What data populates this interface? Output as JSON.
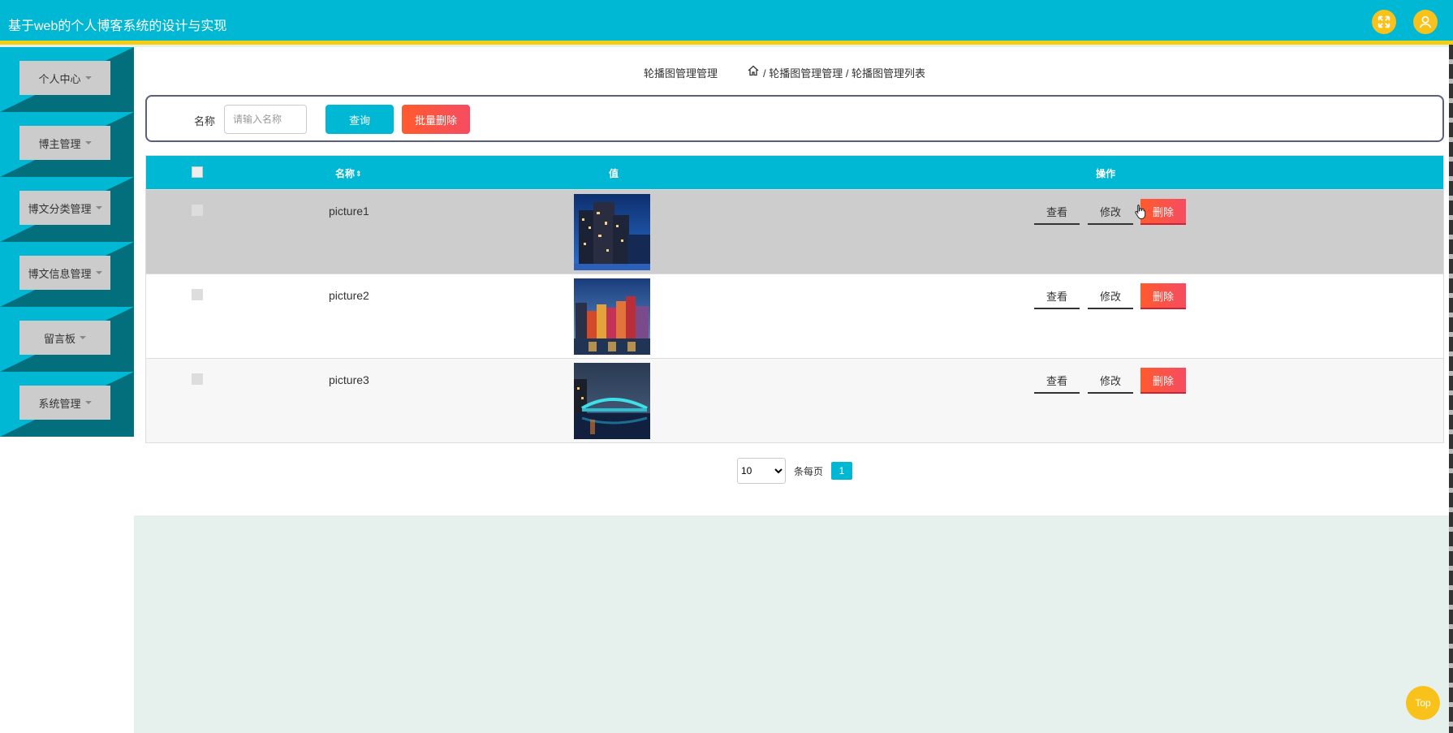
{
  "header": {
    "title": "基于web的个人博客系统的设计与实现",
    "fullscreen_icon": "expand-icon",
    "user_icon": "user-icon",
    "accent": "#00b8d4",
    "stripe": "#f2cf11"
  },
  "sidebar": {
    "items": [
      {
        "label": "个人中心"
      },
      {
        "label": "博主管理"
      },
      {
        "label": "博文分类管理"
      },
      {
        "label": "博文信息管理"
      },
      {
        "label": "留言板"
      },
      {
        "label": "系统管理"
      }
    ]
  },
  "breadcrumb": {
    "title": "轮播图管理管理",
    "path": "/ 轮播图管理管理 / 轮播图管理列表"
  },
  "search": {
    "label": "名称",
    "placeholder": "请输入名称",
    "query_label": "查询",
    "batch_delete_label": "批量删除"
  },
  "table": {
    "headers": {
      "name": "名称",
      "sort": "⇕",
      "value": "值",
      "operation": "操作"
    },
    "rows": [
      {
        "name": "picture1",
        "image": "city-night-image"
      },
      {
        "name": "picture2",
        "image": "colorful-houses-image"
      },
      {
        "name": "picture3",
        "image": "bridge-night-image"
      }
    ],
    "actions": {
      "view": "查看",
      "edit": "修改",
      "delete": "删除"
    }
  },
  "pagination": {
    "page_size": "10",
    "page_size_options": [
      "10"
    ],
    "per_page_label": "条每页",
    "current_page": "1"
  },
  "back_to_top": "Top"
}
